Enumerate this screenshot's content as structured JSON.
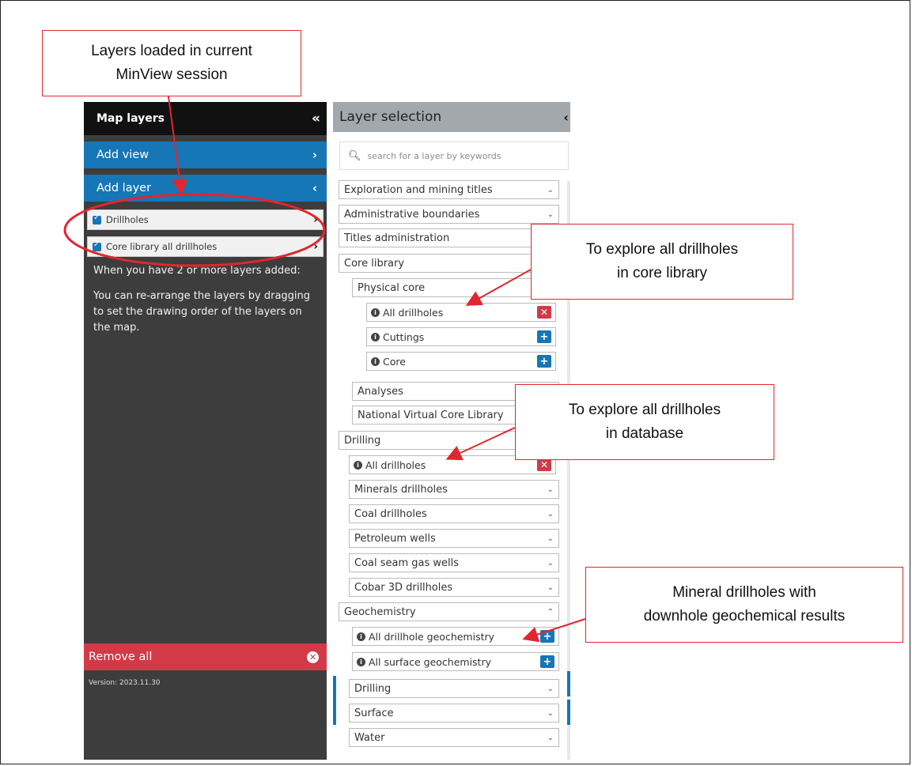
{
  "left_panel": {
    "title": "Map layers",
    "collapse_icon": "«",
    "add_view": "Add view",
    "add_view_chevron": "›",
    "add_layer": "Add layer",
    "add_layer_chevron": "‹",
    "loaded_layers": [
      {
        "label": "Drillholes",
        "checked": true
      },
      {
        "label": "Core library all drillholes",
        "checked": true
      }
    ],
    "help_text_1": "When you have 2 or more layers added:",
    "help_text_2": "You can re-arrange the layers by dragging to set the drawing order of the layers on the map.",
    "remove_all": "Remove all",
    "version": "Version: 2023.11.30"
  },
  "right_panel": {
    "title": "Layer selection",
    "collapse_icon": "‹",
    "search_placeholder": "search for a layer by keywords",
    "categories": {
      "exploration": "Exploration and mining titles",
      "admin_boundaries": "Administrative boundaries",
      "titles_admin": "Titles administration",
      "core_library": "Core library",
      "physical_core": "Physical core",
      "all_drillholes_core": "All drillholes",
      "cuttings": "Cuttings",
      "core": "Core",
      "analyses": "Analyses",
      "national_virtual": "National Virtual Core Library",
      "drilling": "Drilling",
      "all_drillholes_drilling": "All drillholes",
      "minerals_drillholes": "Minerals drillholes",
      "coal_drillholes": "Coal drillholes",
      "petroleum_wells": "Petroleum wells",
      "coal_seam_gas": "Coal seam gas wells",
      "cobar_3d": "Cobar 3D drillholes",
      "geochemistry": "Geochemistry",
      "all_drillhole_geochem": "All drillhole geochemistry",
      "all_surface_geochem": "All surface geochemistry",
      "geo_drilling": "Drilling",
      "geo_surface": "Surface",
      "geo_water": "Water"
    }
  },
  "callouts": {
    "layers_loaded_1": "Layers loaded in current",
    "layers_loaded_2": "MinView session",
    "core_library_1": "To explore all drillholes",
    "core_library_2": "in core library",
    "database_1": "To explore all drillholes",
    "database_2": "in database",
    "geochem_1": "Mineral drillholes with",
    "geochem_2": "downhole geochemical results"
  },
  "colors": {
    "accent_blue": "#1676b6",
    "remove_red": "#d33a47",
    "annotation_red": "#e2262d",
    "panel_dark": "#3d3d3d"
  }
}
